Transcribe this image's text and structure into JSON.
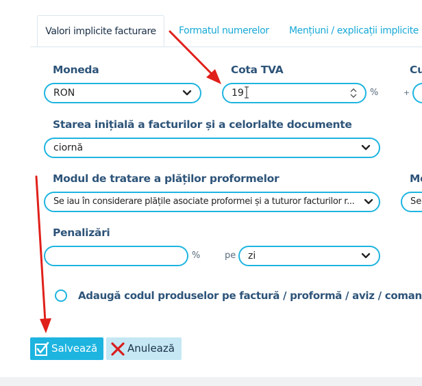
{
  "tabs": [
    {
      "label": "Valori implicite facturare"
    },
    {
      "label": "Formatul numerelor"
    },
    {
      "label": "Mențiuni / explicații implicite"
    }
  ],
  "moneda": {
    "label": "Moneda",
    "value": "RON"
  },
  "cota_tva": {
    "label": "Cota TVA",
    "value": "19",
    "suffix": "%"
  },
  "cu": {
    "label": "Cu",
    "prefix": "+"
  },
  "stare": {
    "label": "Starea inițială a facturilor și a celorlalte documente",
    "value": "ciornă"
  },
  "modul": {
    "label": "Modul de tratare a plăților proformelor",
    "value": "Se iau în considerare plățile asociate proformei și a tuturor facturilor r..."
  },
  "mo": {
    "label": "Mo",
    "value": "Se"
  },
  "penalizari": {
    "label": "Penalizări",
    "value": "",
    "suffix": "%",
    "pe_label": "pe",
    "pe_value": "zi"
  },
  "checkbox": {
    "label": "Adaugă codul produselor pe factură / proformă / aviz / comandă"
  },
  "buttons": {
    "save": "Salvează",
    "cancel": "Anulează"
  },
  "colors": {
    "accent": "#1db4e0",
    "label": "#2e5479",
    "tab_link": "#17a9d6",
    "annotation_arrow": "#e0201a"
  }
}
